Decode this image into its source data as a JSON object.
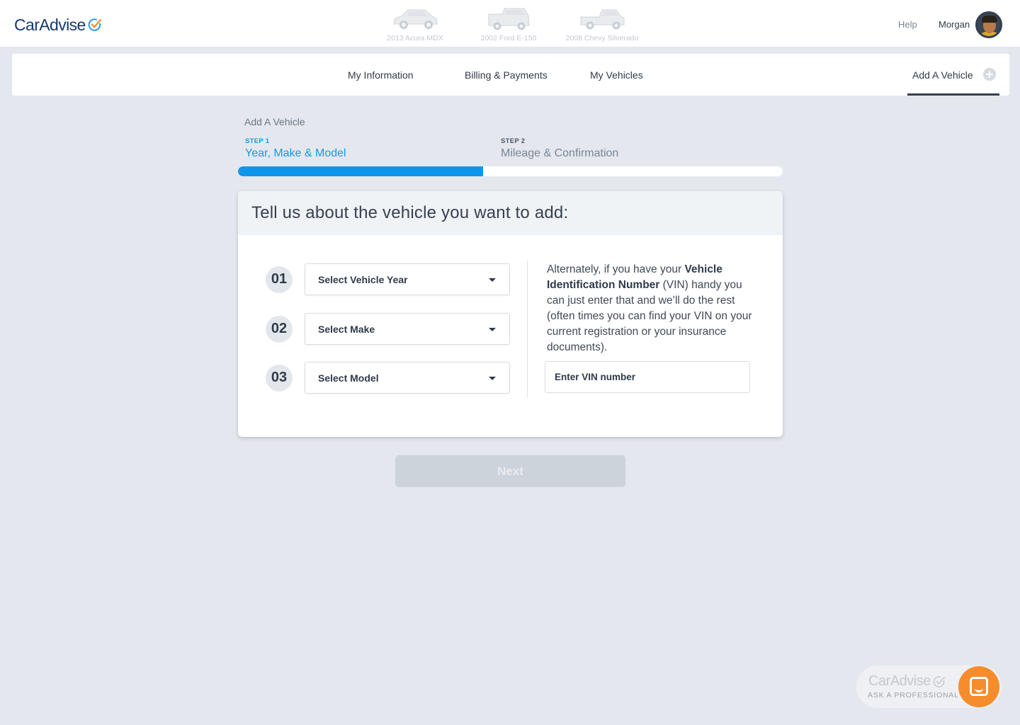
{
  "brand": {
    "name": "CarAdvise"
  },
  "header": {
    "vehicles": [
      {
        "label": "2013 Acura MDX"
      },
      {
        "label": "2002 Ford E-150"
      },
      {
        "label": "2008 Chevy Silverado"
      }
    ],
    "help_label": "Help",
    "user_name": "Morgan"
  },
  "nav": {
    "items": [
      {
        "label": "My Information"
      },
      {
        "label": "Billing & Payments"
      },
      {
        "label": "My Vehicles"
      }
    ],
    "add_vehicle_label": "Add A Vehicle",
    "active": "Add A Vehicle"
  },
  "wizard": {
    "title": "Add A Vehicle",
    "steps": [
      {
        "num": "STEP 1",
        "name": "Year, Make & Model",
        "active": true
      },
      {
        "num": "STEP 2",
        "name": "Mileage & Confirmation",
        "active": false
      }
    ],
    "progress": 0.45
  },
  "form": {
    "heading": "Tell us about the vehicle you want to add:",
    "fields": [
      {
        "num": "01",
        "label": "Select Vehicle Year"
      },
      {
        "num": "02",
        "label": "Select Make"
      },
      {
        "num": "03",
        "label": "Select Model"
      }
    ],
    "vin_text": {
      "before": "Alternately, if you have your ",
      "bold": "Vehicle Identification Number",
      "after": " (VIN) handy you can just enter that and we’ll do the rest (often times you can find your VIN on your current registration or your insurance documents)."
    },
    "vin_placeholder": "Enter VIN number",
    "next_label": "Next"
  },
  "widget": {
    "brand": "CarAdvise",
    "subtitle": "ASK A PROFESSIONAL"
  },
  "colors": {
    "accent": "#0f96ec",
    "navy": "#163a6e",
    "chat": "#f68c2b"
  }
}
